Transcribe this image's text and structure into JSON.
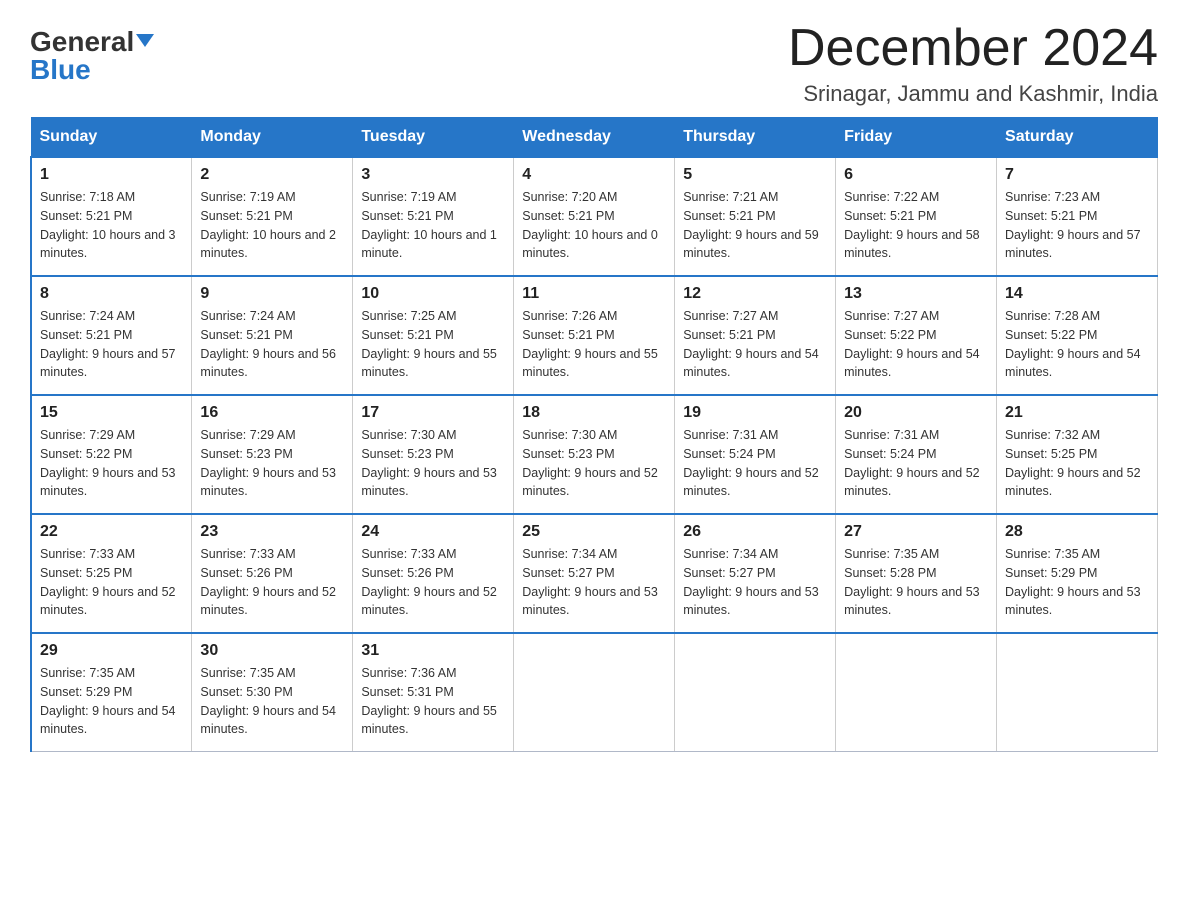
{
  "header": {
    "logo_general": "General",
    "logo_blue": "Blue",
    "month_title": "December 2024",
    "location": "Srinagar, Jammu and Kashmir, India"
  },
  "weekdays": [
    "Sunday",
    "Monday",
    "Tuesday",
    "Wednesday",
    "Thursday",
    "Friday",
    "Saturday"
  ],
  "weeks": [
    [
      {
        "day": "1",
        "sunrise": "7:18 AM",
        "sunset": "5:21 PM",
        "daylight": "10 hours and 3 minutes."
      },
      {
        "day": "2",
        "sunrise": "7:19 AM",
        "sunset": "5:21 PM",
        "daylight": "10 hours and 2 minutes."
      },
      {
        "day": "3",
        "sunrise": "7:19 AM",
        "sunset": "5:21 PM",
        "daylight": "10 hours and 1 minute."
      },
      {
        "day": "4",
        "sunrise": "7:20 AM",
        "sunset": "5:21 PM",
        "daylight": "10 hours and 0 minutes."
      },
      {
        "day": "5",
        "sunrise": "7:21 AM",
        "sunset": "5:21 PM",
        "daylight": "9 hours and 59 minutes."
      },
      {
        "day": "6",
        "sunrise": "7:22 AM",
        "sunset": "5:21 PM",
        "daylight": "9 hours and 58 minutes."
      },
      {
        "day": "7",
        "sunrise": "7:23 AM",
        "sunset": "5:21 PM",
        "daylight": "9 hours and 57 minutes."
      }
    ],
    [
      {
        "day": "8",
        "sunrise": "7:24 AM",
        "sunset": "5:21 PM",
        "daylight": "9 hours and 57 minutes."
      },
      {
        "day": "9",
        "sunrise": "7:24 AM",
        "sunset": "5:21 PM",
        "daylight": "9 hours and 56 minutes."
      },
      {
        "day": "10",
        "sunrise": "7:25 AM",
        "sunset": "5:21 PM",
        "daylight": "9 hours and 55 minutes."
      },
      {
        "day": "11",
        "sunrise": "7:26 AM",
        "sunset": "5:21 PM",
        "daylight": "9 hours and 55 minutes."
      },
      {
        "day": "12",
        "sunrise": "7:27 AM",
        "sunset": "5:21 PM",
        "daylight": "9 hours and 54 minutes."
      },
      {
        "day": "13",
        "sunrise": "7:27 AM",
        "sunset": "5:22 PM",
        "daylight": "9 hours and 54 minutes."
      },
      {
        "day": "14",
        "sunrise": "7:28 AM",
        "sunset": "5:22 PM",
        "daylight": "9 hours and 54 minutes."
      }
    ],
    [
      {
        "day": "15",
        "sunrise": "7:29 AM",
        "sunset": "5:22 PM",
        "daylight": "9 hours and 53 minutes."
      },
      {
        "day": "16",
        "sunrise": "7:29 AM",
        "sunset": "5:23 PM",
        "daylight": "9 hours and 53 minutes."
      },
      {
        "day": "17",
        "sunrise": "7:30 AM",
        "sunset": "5:23 PM",
        "daylight": "9 hours and 53 minutes."
      },
      {
        "day": "18",
        "sunrise": "7:30 AM",
        "sunset": "5:23 PM",
        "daylight": "9 hours and 52 minutes."
      },
      {
        "day": "19",
        "sunrise": "7:31 AM",
        "sunset": "5:24 PM",
        "daylight": "9 hours and 52 minutes."
      },
      {
        "day": "20",
        "sunrise": "7:31 AM",
        "sunset": "5:24 PM",
        "daylight": "9 hours and 52 minutes."
      },
      {
        "day": "21",
        "sunrise": "7:32 AM",
        "sunset": "5:25 PM",
        "daylight": "9 hours and 52 minutes."
      }
    ],
    [
      {
        "day": "22",
        "sunrise": "7:33 AM",
        "sunset": "5:25 PM",
        "daylight": "9 hours and 52 minutes."
      },
      {
        "day": "23",
        "sunrise": "7:33 AM",
        "sunset": "5:26 PM",
        "daylight": "9 hours and 52 minutes."
      },
      {
        "day": "24",
        "sunrise": "7:33 AM",
        "sunset": "5:26 PM",
        "daylight": "9 hours and 52 minutes."
      },
      {
        "day": "25",
        "sunrise": "7:34 AM",
        "sunset": "5:27 PM",
        "daylight": "9 hours and 53 minutes."
      },
      {
        "day": "26",
        "sunrise": "7:34 AM",
        "sunset": "5:27 PM",
        "daylight": "9 hours and 53 minutes."
      },
      {
        "day": "27",
        "sunrise": "7:35 AM",
        "sunset": "5:28 PM",
        "daylight": "9 hours and 53 minutes."
      },
      {
        "day": "28",
        "sunrise": "7:35 AM",
        "sunset": "5:29 PM",
        "daylight": "9 hours and 53 minutes."
      }
    ],
    [
      {
        "day": "29",
        "sunrise": "7:35 AM",
        "sunset": "5:29 PM",
        "daylight": "9 hours and 54 minutes."
      },
      {
        "day": "30",
        "sunrise": "7:35 AM",
        "sunset": "5:30 PM",
        "daylight": "9 hours and 54 minutes."
      },
      {
        "day": "31",
        "sunrise": "7:36 AM",
        "sunset": "5:31 PM",
        "daylight": "9 hours and 55 minutes."
      },
      null,
      null,
      null,
      null
    ]
  ]
}
